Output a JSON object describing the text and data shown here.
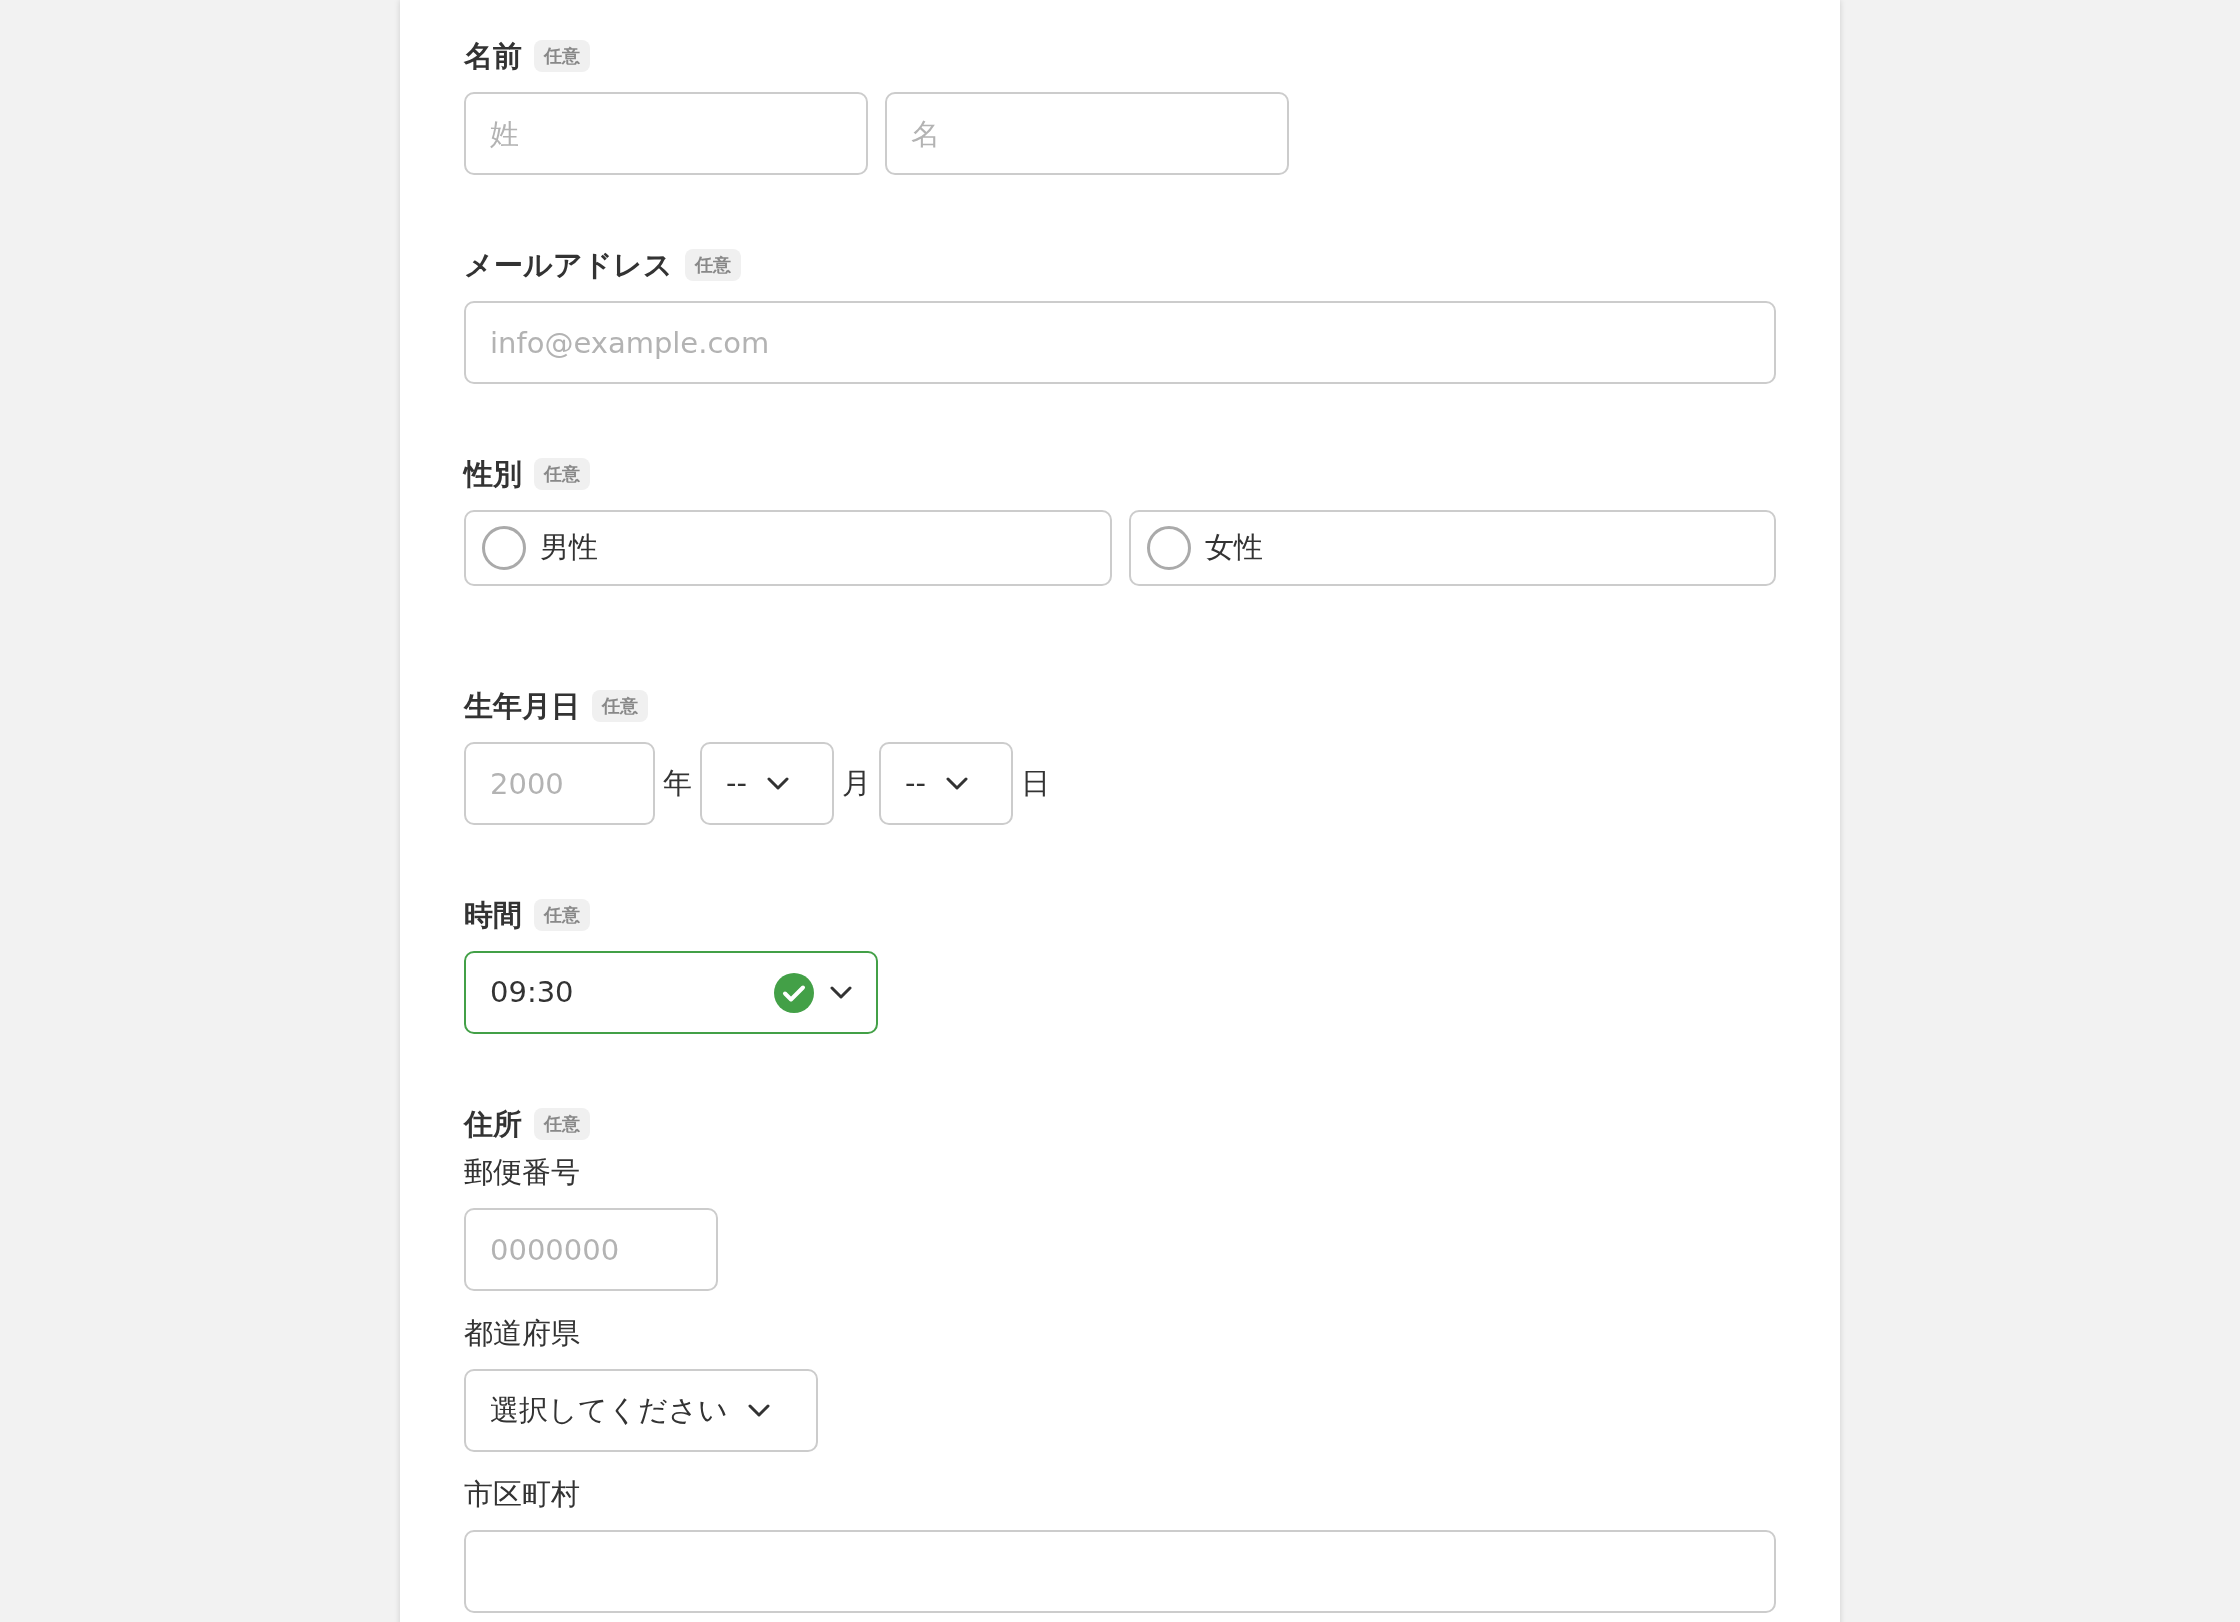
{
  "sections": [
    {
      "kind": "name",
      "label": "名前",
      "badge": "任意",
      "fields": [
        {
          "placeholder": "姓"
        },
        {
          "placeholder": "名"
        }
      ]
    },
    {
      "kind": "email",
      "label": "メールアドレス",
      "badge": "任意",
      "placeholder": "info@example.com"
    },
    {
      "kind": "radio",
      "label": "性別",
      "badge": "任意",
      "options": [
        {
          "label": "男性",
          "selected": false
        },
        {
          "label": "女性",
          "selected": false
        }
      ]
    },
    {
      "kind": "date",
      "label": "生年月日",
      "badge": "任意",
      "year_placeholder": "2000",
      "year_unit": "年",
      "month_value": "--",
      "month_unit": "月",
      "day_value": "--",
      "day_unit": "日"
    },
    {
      "kind": "time",
      "label": "時間",
      "badge": "任意",
      "value": "09:30",
      "valid": true
    },
    {
      "kind": "address",
      "label": "住所",
      "badge": "任意",
      "fields": [
        {
          "kind": "text",
          "label": "郵便番号",
          "placeholder": "0000000"
        },
        {
          "kind": "select",
          "label": "都道府県",
          "value": "選択してください"
        },
        {
          "kind": "text",
          "label": "市区町村"
        }
      ]
    }
  ]
}
